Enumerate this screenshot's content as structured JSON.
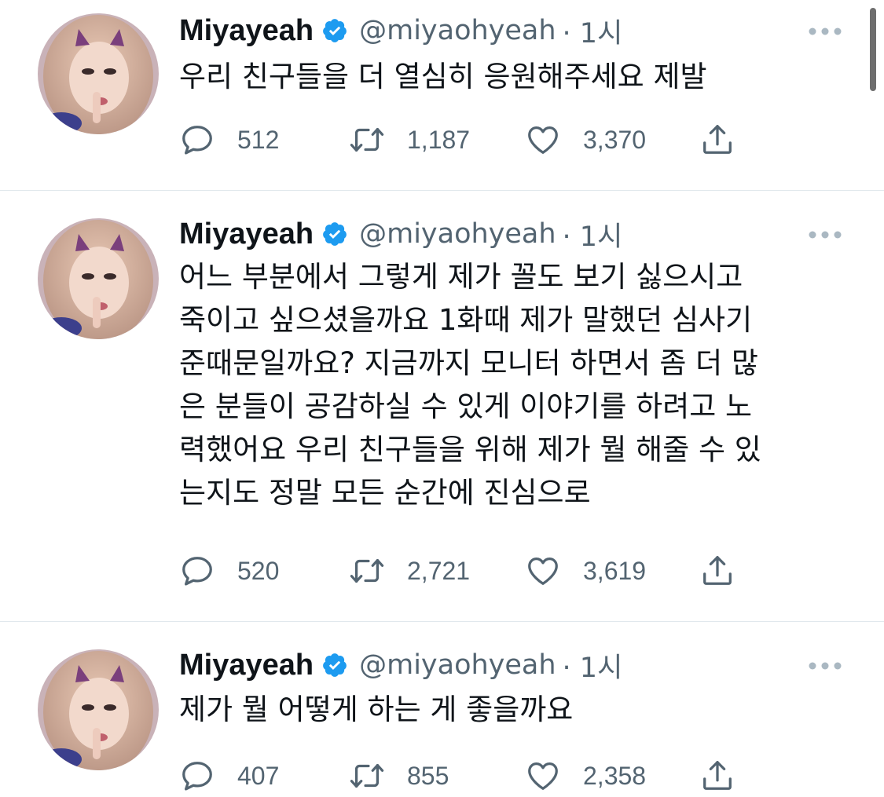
{
  "tweets": [
    {
      "name": "Miyayeah",
      "handle": "@miyaohyeah",
      "time": "· 1시",
      "text": "우리 친구들을 더 열심히 응원해주세요 제발",
      "reply_count": "512",
      "retweet_count": "1,187",
      "like_count": "3,370"
    },
    {
      "name": "Miyayeah",
      "handle": "@miyaohyeah",
      "time": "· 1시",
      "text_lines": [
        "어느 부분에서 그렇게 제가 꼴도 보기 싫으시고",
        "죽이고 싶으셨을까요 1화때 제가 말했던 심사기",
        "준때문일까요? 지금까지 모니터 하면서 좀 더 많",
        "은 분들이 공감하실 수 있게 이야기를 하려고 노",
        "력했어요 우리 친구들을 위해 제가 뭘 해줄 수 있",
        "는지도 정말 모든 순간에 진심으로"
      ],
      "reply_count": "520",
      "retweet_count": "2,721",
      "like_count": "3,619"
    },
    {
      "name": "Miyayeah",
      "handle": "@miyaohyeah",
      "time": "· 1시",
      "text": "제가 뭘 어떻게 하는 게 좋을까요",
      "reply_count": "407",
      "retweet_count": "855",
      "like_count": "2,358"
    }
  ],
  "icons": {
    "verified": "verified-badge-icon",
    "more": "more-dots-icon",
    "reply": "reply-icon",
    "retweet": "retweet-icon",
    "like": "heart-icon",
    "share": "share-icon"
  },
  "colors": {
    "verified_blue": "#1d9bf0",
    "icon_gray": "#536471",
    "divider": "#e1e8ed"
  }
}
